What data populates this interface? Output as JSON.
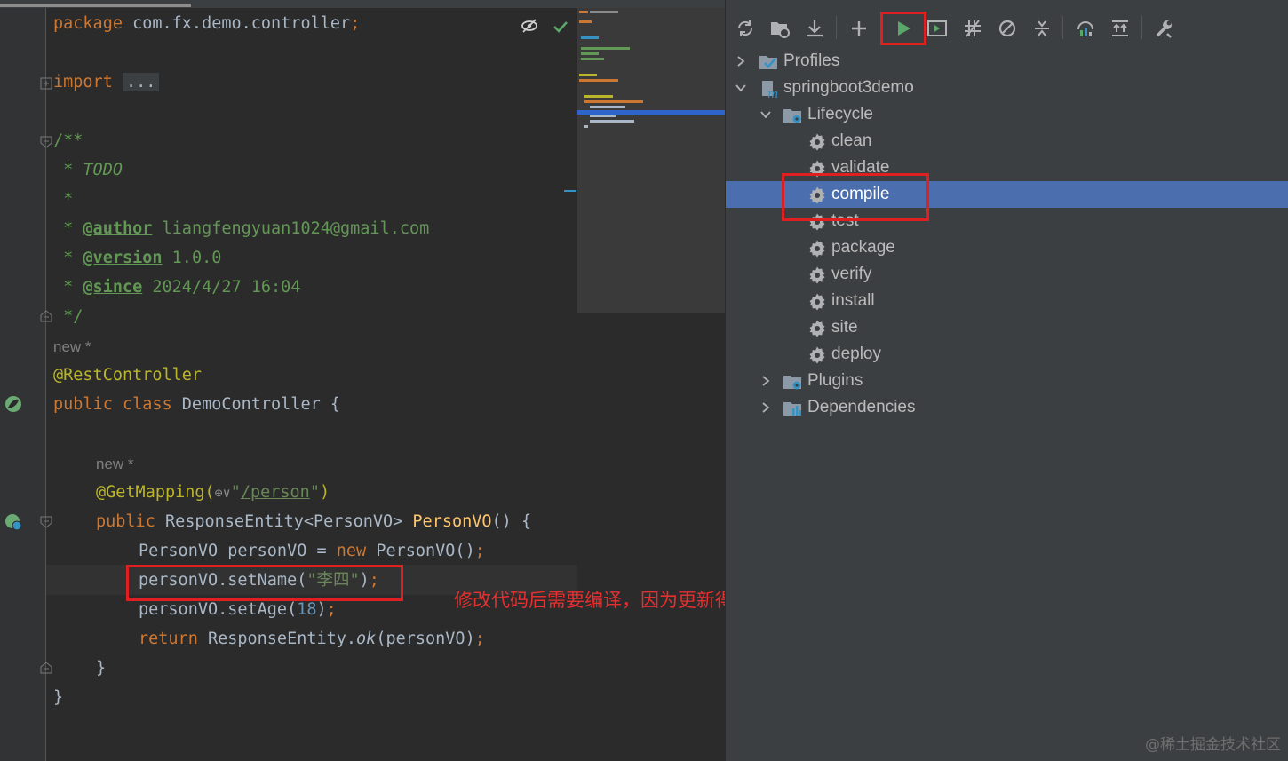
{
  "editor": {
    "package_kw": "package",
    "package_name": " com.fx.demo.controller",
    "semicolon": ";",
    "import_kw": "import",
    "import_fold": "...",
    "doc_open": "/**",
    "doc_star": " * ",
    "doc_todo": "TODO",
    "doc_star_only": " *",
    "author_tag": "@author",
    "author_value": " liangfengyuan1024@gmail.com",
    "version_tag": "@version",
    "version_value": " 1.0.0",
    "since_tag": "@since",
    "since_value": " 2024/4/27 16:04",
    "doc_close": " */",
    "hint_new_1": "new *",
    "rest_controller": "@RestController",
    "class_kw": "public class",
    "class_name": " DemoController {",
    "hint_new_2": "new *",
    "get_mapping": "@GetMapping(",
    "mapping_icons": "⊕∨",
    "mapping_path_q1": "\"",
    "mapping_path": "/person",
    "mapping_path_q2": "\"",
    "mapping_close": ")",
    "method_kw": "public",
    "method_type": " ResponseEntity<PersonVO> ",
    "method_name": "PersonVO",
    "method_rest": "() {",
    "line_new_type": "PersonVO personVO = ",
    "line_new_kw": "new",
    "line_new_rest": " PersonVO()",
    "line_setname_a": "personVO.setName(",
    "line_setname_str": "\"李四\"",
    "line_setname_b": ")",
    "line_setage_a": "personVO.setAge(",
    "line_setage_num": "18",
    "line_setage_b": ")",
    "return_kw": "return",
    "return_a": " ResponseEntity.",
    "return_ok": "ok",
    "return_b": "(personVO)",
    "close_method": "}",
    "close_class": "}"
  },
  "annotation_note": "修改代码后需要编译，因为更新得是class文件",
  "maven": {
    "toolbar": [
      {
        "name": "reload-icon"
      },
      {
        "name": "generate-sources-icon"
      },
      {
        "name": "download-icon"
      },
      {
        "name": "add-icon"
      },
      {
        "name": "run-icon"
      },
      {
        "name": "execute-goal-icon"
      },
      {
        "name": "toggle-offline-icon"
      },
      {
        "name": "skip-tests-icon"
      },
      {
        "name": "collapse-all-icon"
      },
      {
        "name": "analyze-dependencies-icon"
      },
      {
        "name": "show-dependencies-icon"
      },
      {
        "name": "settings-wrench-icon"
      }
    ],
    "tree": {
      "profiles": "Profiles",
      "project": "springboot3demo",
      "lifecycle": "Lifecycle",
      "goals": [
        "clean",
        "validate",
        "compile",
        "test",
        "package",
        "verify",
        "install",
        "site",
        "deploy"
      ],
      "selected_goal": "compile",
      "plugins": "Plugins",
      "dependencies": "Dependencies"
    }
  },
  "watermark": "@稀土掘金技术社区",
  "colors": {
    "editor_bg": "#2b2b2b",
    "panel_bg": "#3c3f41",
    "selection": "#4b6eaf",
    "annotation_red": "#e02020",
    "run_green": "#59a869"
  }
}
